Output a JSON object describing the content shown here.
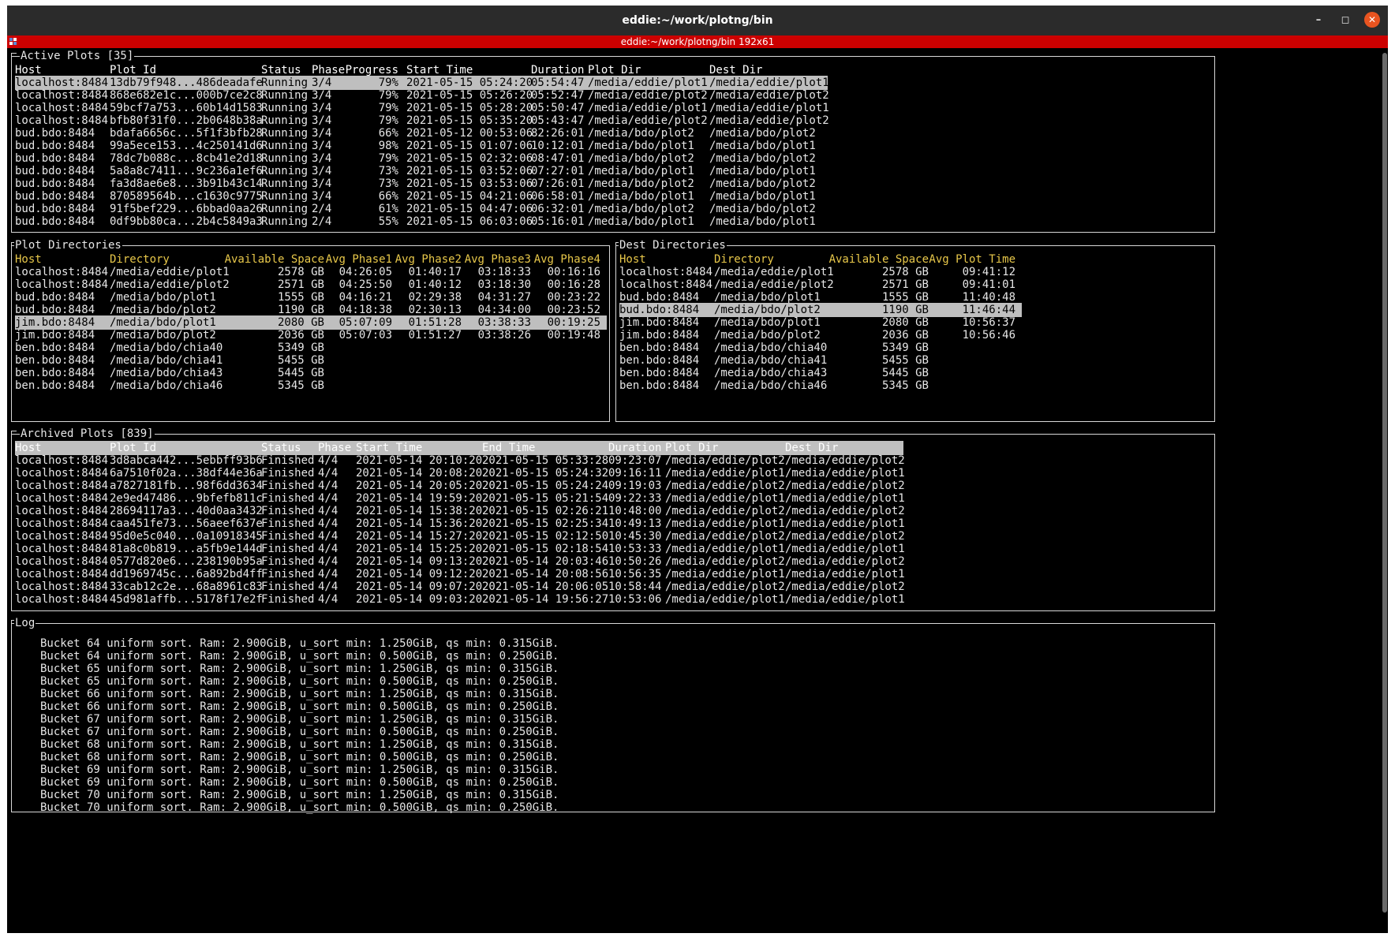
{
  "window": {
    "title": "eddie:~/work/plotng/bin",
    "tab_title": "eddie:~/work/plotng/bin 192x61"
  },
  "active": {
    "title": "Active Plots [35]",
    "headers": [
      "Host",
      "Plot Id",
      "Status",
      "Phase",
      "Progress",
      "Start Time",
      "Duration",
      "Plot Dir",
      "Dest Dir"
    ],
    "selected": 0,
    "rows": [
      [
        "localhost:8484",
        "13db79f948...486deadafe",
        "Running",
        "3/4",
        "79%",
        "2021-05-15 05:24:20",
        "05:54:47",
        "/media/eddie/plot1",
        "/media/eddie/plot1"
      ],
      [
        "localhost:8484",
        "868e682e1c...000b7ce2c8",
        "Running",
        "3/4",
        "79%",
        "2021-05-15 05:26:20",
        "05:52:47",
        "/media/eddie/plot2",
        "/media/eddie/plot2"
      ],
      [
        "localhost:8484",
        "59bcf7a753...60b14d1583",
        "Running",
        "3/4",
        "79%",
        "2021-05-15 05:28:20",
        "05:50:47",
        "/media/eddie/plot1",
        "/media/eddie/plot1"
      ],
      [
        "localhost:8484",
        "bfb80f31f0...2b0648b38a",
        "Running",
        "3/4",
        "79%",
        "2021-05-15 05:35:20",
        "05:43:47",
        "/media/eddie/plot2",
        "/media/eddie/plot2"
      ],
      [
        "bud.bdo:8484",
        "bdafa6656c...5f1f3bfb28",
        "Running",
        "3/4",
        "66%",
        "2021-05-12 00:53:06",
        "82:26:01",
        "/media/bdo/plot2",
        "/media/bdo/plot2"
      ],
      [
        "bud.bdo:8484",
        "99a5ece153...4c250141d6",
        "Running",
        "3/4",
        "98%",
        "2021-05-15 01:07:06",
        "10:12:01",
        "/media/bdo/plot1",
        "/media/bdo/plot1"
      ],
      [
        "bud.bdo:8484",
        "78dc7b088c...8cb41e2d18",
        "Running",
        "3/4",
        "79%",
        "2021-05-15 02:32:06",
        "08:47:01",
        "/media/bdo/plot2",
        "/media/bdo/plot2"
      ],
      [
        "bud.bdo:8484",
        "5a8a8c7411...9c236a1ef6",
        "Running",
        "3/4",
        "73%",
        "2021-05-15 03:52:06",
        "07:27:01",
        "/media/bdo/plot1",
        "/media/bdo/plot1"
      ],
      [
        "bud.bdo:8484",
        "fa3d8ae6e8...3b91b43c14",
        "Running",
        "3/4",
        "73%",
        "2021-05-15 03:53:06",
        "07:26:01",
        "/media/bdo/plot2",
        "/media/bdo/plot2"
      ],
      [
        "bud.bdo:8484",
        "870589564b...c1630c9775",
        "Running",
        "3/4",
        "66%",
        "2021-05-15 04:21:06",
        "06:58:01",
        "/media/bdo/plot1",
        "/media/bdo/plot1"
      ],
      [
        "bud.bdo:8484",
        "91f5bef229...6bbad0aa26",
        "Running",
        "2/4",
        "61%",
        "2021-05-15 04:47:06",
        "06:32:01",
        "/media/bdo/plot2",
        "/media/bdo/plot2"
      ],
      [
        "bud.bdo:8484",
        "0df9bb80ca...2b4c5849a3",
        "Running",
        "2/4",
        "55%",
        "2021-05-15 06:03:06",
        "05:16:01",
        "/media/bdo/plot1",
        "/media/bdo/plot1"
      ]
    ]
  },
  "plotdirs": {
    "title": "Plot Directories",
    "headers": [
      "Host",
      "Directory",
      "Available Space",
      "Avg Phase1",
      "Avg Phase2",
      "Avg Phase3",
      "Avg Phase4"
    ],
    "selected": 4,
    "rows": [
      [
        "localhost:8484",
        "/media/eddie/plot1",
        "2578 GB",
        "04:26:05",
        "01:40:17",
        "03:18:33",
        "00:16:16"
      ],
      [
        "localhost:8484",
        "/media/eddie/plot2",
        "2571 GB",
        "04:25:50",
        "01:40:12",
        "03:18:30",
        "00:16:28"
      ],
      [
        "bud.bdo:8484",
        "/media/bdo/plot1",
        "1555 GB",
        "04:16:21",
        "02:29:38",
        "04:31:27",
        "00:23:22"
      ],
      [
        "bud.bdo:8484",
        "/media/bdo/plot2",
        "1190 GB",
        "04:18:38",
        "02:30:13",
        "04:34:00",
        "00:23:52"
      ],
      [
        "jim.bdo:8484",
        "/media/bdo/plot1",
        "2080 GB",
        "05:07:09",
        "01:51:28",
        "03:38:33",
        "00:19:25"
      ],
      [
        "jim.bdo:8484",
        "/media/bdo/plot2",
        "2036 GB",
        "05:07:03",
        "01:51:27",
        "03:38:26",
        "00:19:48"
      ],
      [
        "ben.bdo:8484",
        "/media/bdo/chia40",
        "5349 GB",
        "",
        "",
        "",
        ""
      ],
      [
        "ben.bdo:8484",
        "/media/bdo/chia41",
        "5455 GB",
        "",
        "",
        "",
        ""
      ],
      [
        "ben.bdo:8484",
        "/media/bdo/chia43",
        "5445 GB",
        "",
        "",
        "",
        ""
      ],
      [
        "ben.bdo:8484",
        "/media/bdo/chia46",
        "5345 GB",
        "",
        "",
        "",
        ""
      ]
    ]
  },
  "destdirs": {
    "title": "Dest Directories",
    "headers": [
      "Host",
      "Directory",
      "Available Space",
      "Avg Plot Time"
    ],
    "selected": 3,
    "rows": [
      [
        "localhost:8484",
        "/media/eddie/plot1",
        "2578 GB",
        "09:41:12"
      ],
      [
        "localhost:8484",
        "/media/eddie/plot2",
        "2571 GB",
        "09:41:01"
      ],
      [
        "bud.bdo:8484",
        "/media/bdo/plot1",
        "1555 GB",
        "11:40:48"
      ],
      [
        "bud.bdo:8484",
        "/media/bdo/plot2",
        "1190 GB",
        "11:46:44"
      ],
      [
        "jim.bdo:8484",
        "/media/bdo/plot1",
        "2080 GB",
        "10:56:37"
      ],
      [
        "jim.bdo:8484",
        "/media/bdo/plot2",
        "2036 GB",
        "10:56:46"
      ],
      [
        "ben.bdo:8484",
        "/media/bdo/chia40",
        "5349 GB",
        ""
      ],
      [
        "ben.bdo:8484",
        "/media/bdo/chia41",
        "5455 GB",
        ""
      ],
      [
        "ben.bdo:8484",
        "/media/bdo/chia43",
        "5445 GB",
        ""
      ],
      [
        "ben.bdo:8484",
        "/media/bdo/chia46",
        "5345 GB",
        ""
      ]
    ]
  },
  "archived": {
    "title": "Archived Plots [839]",
    "headers": [
      "Host",
      "Plot Id",
      "Status",
      "Phase",
      "Start Time",
      "End Time",
      "Duration",
      "Plot Dir",
      "Dest Dir"
    ],
    "rows": [
      [
        "localhost:8484",
        "3d8abca442...5ebbff93b6",
        "Finished",
        "4/4",
        "2021-05-14 20:10:20",
        "2021-05-15 05:33:28",
        "09:23:07",
        "/media/eddie/plot2",
        "/media/eddie/plot2"
      ],
      [
        "localhost:8484",
        "6a7510f02a...38df44e36a",
        "Finished",
        "4/4",
        "2021-05-14 20:08:20",
        "2021-05-15 05:24:32",
        "09:16:11",
        "/media/eddie/plot1",
        "/media/eddie/plot1"
      ],
      [
        "localhost:8484",
        "a7827181fb...98f6dd3634",
        "Finished",
        "4/4",
        "2021-05-14 20:05:20",
        "2021-05-15 05:24:24",
        "09:19:03",
        "/media/eddie/plot2",
        "/media/eddie/plot2"
      ],
      [
        "localhost:8484",
        "2e9ed47486...9bfefb811c",
        "Finished",
        "4/4",
        "2021-05-14 19:59:20",
        "2021-05-15 05:21:54",
        "09:22:33",
        "/media/eddie/plot1",
        "/media/eddie/plot1"
      ],
      [
        "localhost:8484",
        "28694117a3...40d0aa3432",
        "Finished",
        "4/4",
        "2021-05-14 15:38:20",
        "2021-05-15 02:26:21",
        "10:48:00",
        "/media/eddie/plot2",
        "/media/eddie/plot2"
      ],
      [
        "localhost:8484",
        "caa451fe73...56aeef637e",
        "Finished",
        "4/4",
        "2021-05-14 15:36:20",
        "2021-05-15 02:25:34",
        "10:49:13",
        "/media/eddie/plot1",
        "/media/eddie/plot1"
      ],
      [
        "localhost:8484",
        "95d0e5c040...0a10918345",
        "Finished",
        "4/4",
        "2021-05-14 15:27:20",
        "2021-05-15 02:12:50",
        "10:45:30",
        "/media/eddie/plot2",
        "/media/eddie/plot2"
      ],
      [
        "localhost:8484",
        "81a8c0b819...a5fb9e144d",
        "Finished",
        "4/4",
        "2021-05-14 15:25:20",
        "2021-05-15 02:18:54",
        "10:53:33",
        "/media/eddie/plot1",
        "/media/eddie/plot1"
      ],
      [
        "localhost:8484",
        "0577d820e6...238190b95a",
        "Finished",
        "4/4",
        "2021-05-14 09:13:20",
        "2021-05-14 20:03:46",
        "10:50:26",
        "/media/eddie/plot2",
        "/media/eddie/plot2"
      ],
      [
        "localhost:8484",
        "dd1969745c...6a892bd4ff",
        "Finished",
        "4/4",
        "2021-05-14 09:12:20",
        "2021-05-14 20:08:56",
        "10:56:35",
        "/media/eddie/plot1",
        "/media/eddie/plot1"
      ],
      [
        "localhost:8484",
        "33cab12c2e...68a8961c83",
        "Finished",
        "4/4",
        "2021-05-14 09:07:20",
        "2021-05-14 20:06:05",
        "10:58:44",
        "/media/eddie/plot2",
        "/media/eddie/plot2"
      ],
      [
        "localhost:8484",
        "45d981affb...5178f17e2f",
        "Finished",
        "4/4",
        "2021-05-14 09:03:20",
        "2021-05-14 19:56:27",
        "10:53:06",
        "/media/eddie/plot1",
        "/media/eddie/plot1"
      ]
    ]
  },
  "log": {
    "title": "Log",
    "lines": [
      "Bucket 64 uniform sort. Ram: 2.900GiB, u_sort min: 1.250GiB, qs min: 0.315GiB.",
      "Bucket 64 uniform sort. Ram: 2.900GiB, u_sort min: 0.500GiB, qs min: 0.250GiB.",
      "Bucket 65 uniform sort. Ram: 2.900GiB, u_sort min: 1.250GiB, qs min: 0.315GiB.",
      "Bucket 65 uniform sort. Ram: 2.900GiB, u_sort min: 0.500GiB, qs min: 0.250GiB.",
      "Bucket 66 uniform sort. Ram: 2.900GiB, u_sort min: 1.250GiB, qs min: 0.315GiB.",
      "Bucket 66 uniform sort. Ram: 2.900GiB, u_sort min: 0.500GiB, qs min: 0.250GiB.",
      "Bucket 67 uniform sort. Ram: 2.900GiB, u_sort min: 1.250GiB, qs min: 0.315GiB.",
      "Bucket 67 uniform sort. Ram: 2.900GiB, u_sort min: 0.500GiB, qs min: 0.250GiB.",
      "Bucket 68 uniform sort. Ram: 2.900GiB, u_sort min: 1.250GiB, qs min: 0.315GiB.",
      "Bucket 68 uniform sort. Ram: 2.900GiB, u_sort min: 0.500GiB, qs min: 0.250GiB.",
      "Bucket 69 uniform sort. Ram: 2.900GiB, u_sort min: 1.250GiB, qs min: 0.315GiB.",
      "Bucket 69 uniform sort. Ram: 2.900GiB, u_sort min: 0.500GiB, qs min: 0.250GiB.",
      "Bucket 70 uniform sort. Ram: 2.900GiB, u_sort min: 1.250GiB, qs min: 0.315GiB.",
      "Bucket 70 uniform sort. Ram: 2.900GiB, u_sort min: 0.500GiB, qs min: 0.250GiB."
    ]
  },
  "colors": {
    "header_yellow": "#e8c84a",
    "selection": "#bfbfbf",
    "tab_red": "#cc0000"
  },
  "icons": {
    "minimize": "minimize-icon",
    "maximize": "maximize-icon",
    "close": "close-icon",
    "terminal": "terminal-icon"
  }
}
